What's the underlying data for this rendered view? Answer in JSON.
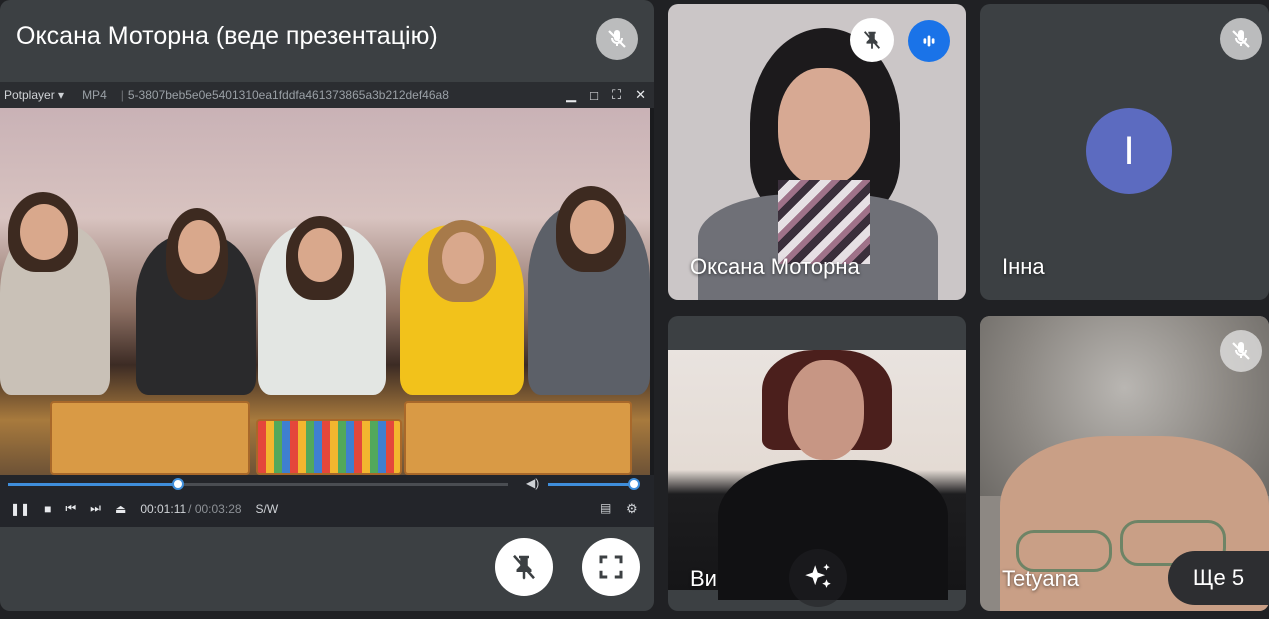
{
  "presentation": {
    "title": "Оксана Моторна (веде презентацію)",
    "player": {
      "app_label": "Potplayer ▾",
      "format": "MP4",
      "separator": "|",
      "filename": "5-3807beb5e0e5401310ea1fddfa461373865a3b212def46a8",
      "time_current": "00:01:11",
      "time_total": " / 00:03:28",
      "mode": "S/W",
      "progress_fraction": 0.34,
      "volume_fraction": 1.0
    }
  },
  "participants": [
    {
      "name": "Оксана Моторна"
    },
    {
      "name": "Інна",
      "avatar_letter": "I",
      "avatar_color": "#5c6bc0"
    },
    {
      "name": "Ви"
    },
    {
      "name": "Tetyana"
    }
  ],
  "more_label": "Ще 5",
  "colors": {
    "background": "#202124",
    "tile": "#3c4043",
    "accent": "#1a73e8"
  },
  "icons": [
    "mic-off-icon",
    "unpin-icon",
    "audio-level-icon",
    "fullscreen-icon",
    "sparkle-icon"
  ]
}
